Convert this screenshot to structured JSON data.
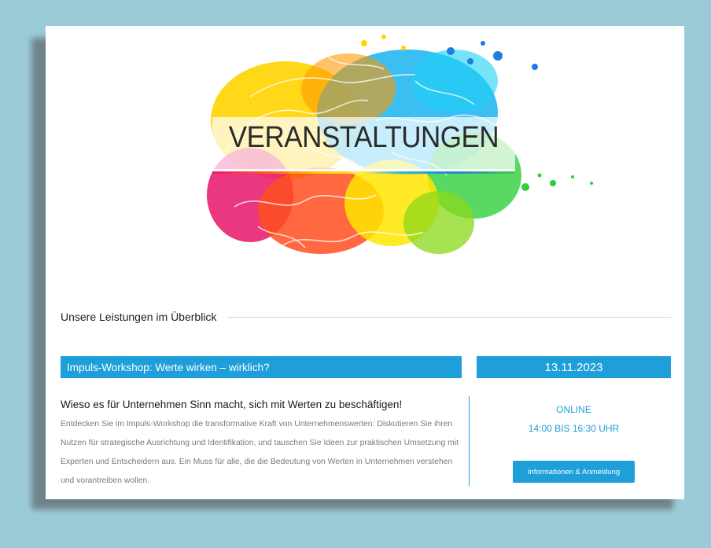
{
  "hero": {
    "title": "VERANSTALTUNGEN",
    "image": "colorful-brain-illustration"
  },
  "overview": {
    "label": "Unsere Leistungen im Überblick"
  },
  "event": {
    "title": "Impuls-Workshop: Werte wirken – wirklich?",
    "date": "13.11.2023",
    "heading": "Wieso es für Unternehmen Sinn macht, sich mit Werten zu beschäftigen!",
    "description": "Entdecken Sie im Impuls-Workshop die transformative Kraft von Unternehmenswerten: Diskutieren Sie ihren Nutzen für strategische Ausrichtung und Identifikation, und tauschen Sie Ideen zur praktischen Umsetzung mit Experten und Entscheidern aus. Ein Muss für alle, die die Bedeutung von Werten in Unternehmen verstehen und vorantreiben wollen.",
    "mode": "ONLINE",
    "time": "14:00 BIS 16:30 UHR",
    "button_label": "Informationen & Anmeldung"
  },
  "colors": {
    "accent": "#1e9fd9",
    "background": "#9ccbd8"
  }
}
